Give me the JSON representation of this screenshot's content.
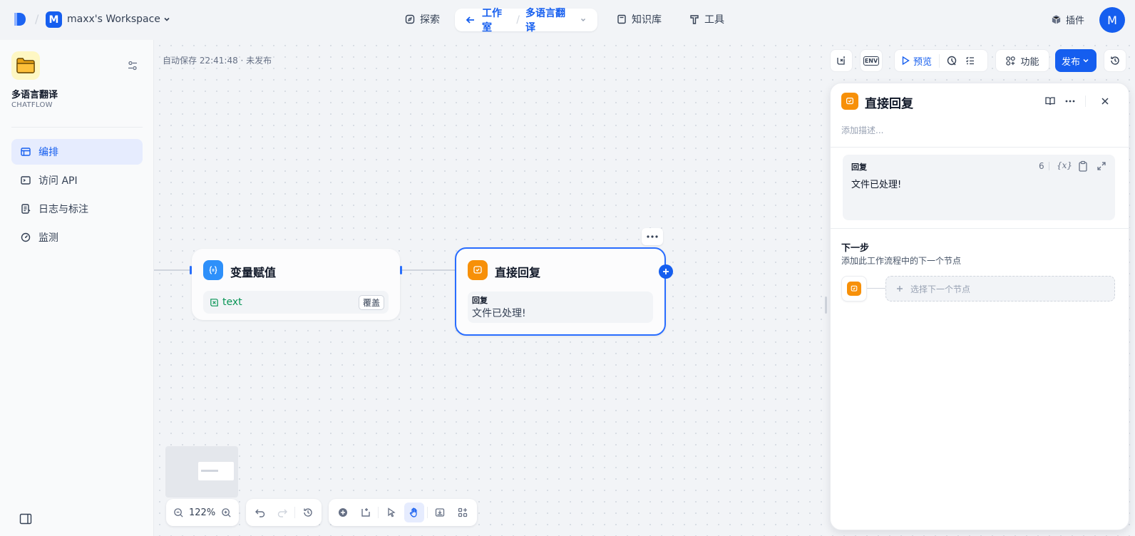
{
  "header": {
    "workspace_initial": "M",
    "workspace_name": "maxx's Workspace",
    "nav_explore": "探索",
    "nav_studio": "工作室",
    "nav_app": "多语言翻译",
    "nav_knowledge": "知识库",
    "nav_tools": "工具",
    "plugins": "插件",
    "avatar_initial": "M"
  },
  "sidebar": {
    "app_name": "多语言翻译",
    "app_type": "CHATFLOW",
    "items": [
      {
        "label": "编排",
        "icon": "layout-icon"
      },
      {
        "label": "访问 API",
        "icon": "terminal-icon"
      },
      {
        "label": "日志与标注",
        "icon": "file-list-icon"
      },
      {
        "label": "监测",
        "icon": "gauge-icon"
      }
    ]
  },
  "canvas": {
    "autosave": "自动保存 22:41:48 · 未发布",
    "zoom": "122%"
  },
  "nodes": {
    "assign": {
      "title": "变量赋值",
      "var": "text",
      "mode": "覆盖"
    },
    "answer": {
      "title": "直接回复",
      "label": "回复",
      "content": "文件已处理!"
    }
  },
  "toolbar": {
    "preview": "预览",
    "features": "功能",
    "publish": "发布",
    "env": "ENV"
  },
  "panel": {
    "title": "直接回复",
    "desc_placeholder": "添加描述...",
    "reply_label": "回复",
    "reply_count": "6",
    "reply_var": "{x}",
    "reply_text": "文件已处理!",
    "next_title": "下一步",
    "next_desc": "添加此工作流程中的下一个节点",
    "next_select": "选择下一个节点"
  },
  "colors": {
    "accent": "#155eef",
    "answer_orange": "#f79009",
    "assign_blue": "#2e90fa",
    "assign_green": "#079455"
  }
}
